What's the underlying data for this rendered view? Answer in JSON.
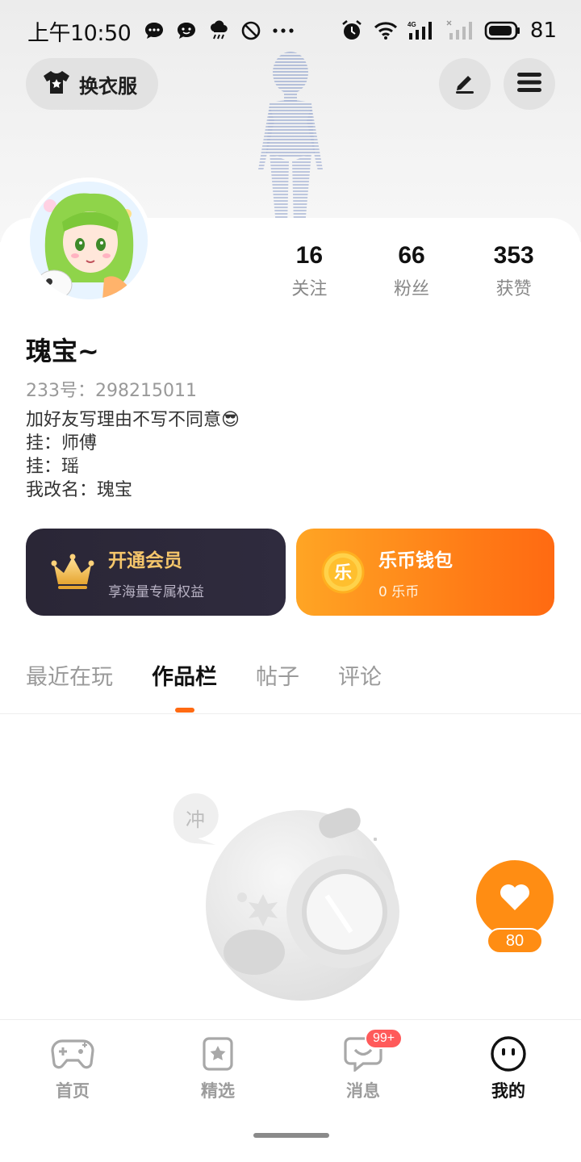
{
  "status_bar": {
    "time": "上午10:50",
    "network": "4G",
    "battery": "81"
  },
  "header": {
    "outfit_label": "换衣服",
    "edit_icon": "edit-icon",
    "menu_icon": "menu-icon"
  },
  "profile": {
    "username": "瑰宝~",
    "uid": "233号：298215011",
    "bio": [
      "加好友写理由不写不同意😎",
      "挂：师傅",
      "挂：瑶",
      "我改名：瑰宝"
    ],
    "stats": [
      {
        "num": "16",
        "label": "关注"
      },
      {
        "num": "66",
        "label": "粉丝"
      },
      {
        "num": "353",
        "label": "获赞"
      }
    ]
  },
  "promos": {
    "vip": {
      "title": "开通会员",
      "subtitle": "享海量专属权益"
    },
    "wallet": {
      "title": "乐币钱包",
      "subtitle": "0 乐币",
      "coin_char": "乐"
    }
  },
  "tabs": [
    {
      "label": "最近在玩",
      "active": false
    },
    {
      "label": "作品栏",
      "active": true
    },
    {
      "label": "帖子",
      "active": false
    },
    {
      "label": "评论",
      "active": false
    }
  ],
  "empty_state": {
    "bubble_text": "冲"
  },
  "like": {
    "count": "80"
  },
  "bottom_nav": [
    {
      "label": "首页",
      "icon": "gamepad-icon",
      "active": false
    },
    {
      "label": "精选",
      "icon": "star-bookmark-icon",
      "active": false
    },
    {
      "label": "消息",
      "icon": "chat-icon",
      "active": false,
      "badge": "99+"
    },
    {
      "label": "我的",
      "icon": "face-icon",
      "active": true
    }
  ],
  "colors": {
    "accent": "#ff6a12",
    "wallet": "#ff8d13",
    "vip_bg": "#2a2636",
    "vip_text": "#f5c66b"
  }
}
